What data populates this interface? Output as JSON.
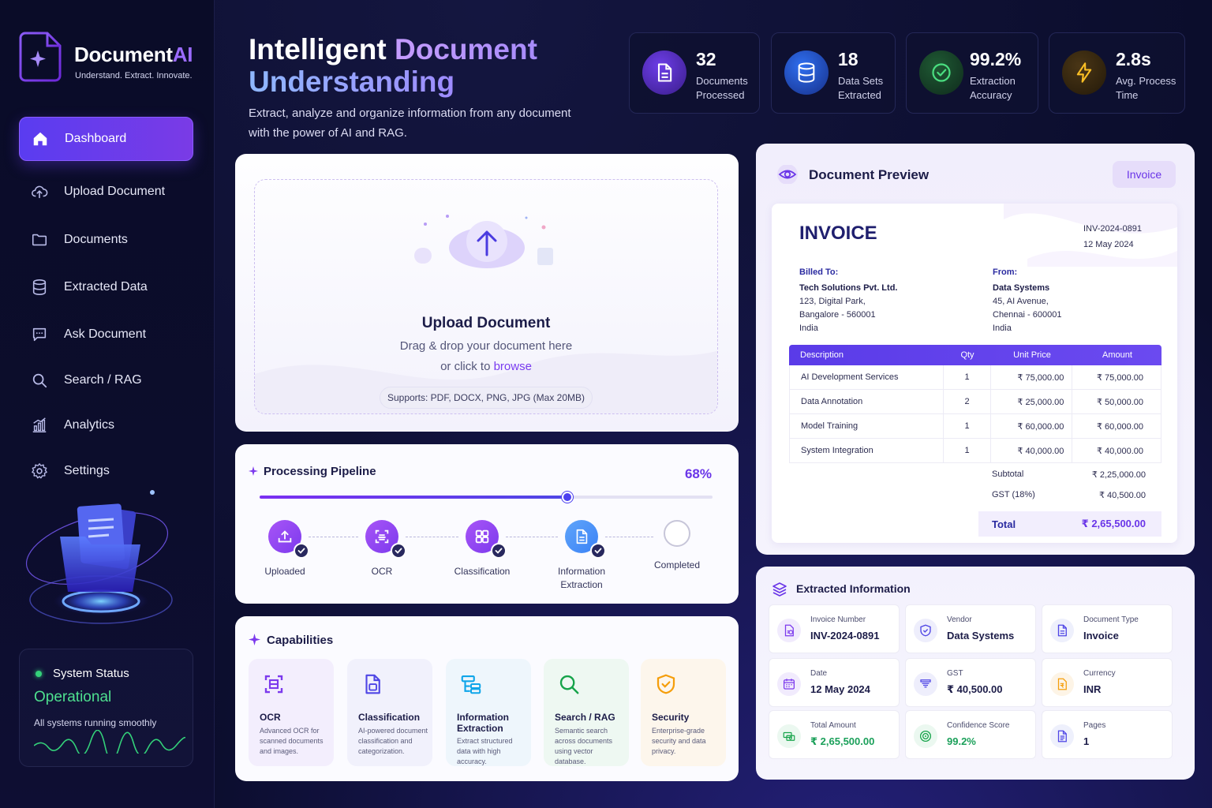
{
  "brand": {
    "name_main": "Document",
    "name_accent": "AI",
    "tagline": "Understand. Extract. Innovate."
  },
  "nav": [
    {
      "label": "Dashboard",
      "icon": "home-icon",
      "active": true
    },
    {
      "label": "Upload Document",
      "icon": "cloud-upload-icon"
    },
    {
      "label": "Documents",
      "icon": "folder-icon"
    },
    {
      "label": "Extracted Data",
      "icon": "database-icon"
    },
    {
      "label": "Ask Document",
      "icon": "chat-icon"
    },
    {
      "label": "Search / RAG",
      "icon": "search-icon"
    },
    {
      "label": "Analytics",
      "icon": "analytics-icon"
    },
    {
      "label": "Settings",
      "icon": "gear-icon"
    }
  ],
  "system_status": {
    "label": "System Status",
    "state": "Operational",
    "message": "All systems running smoothly"
  },
  "hero": {
    "title_white": "Intelligent",
    "title_accent1": "Document",
    "title_accent2": "Understanding",
    "subtitle": "Extract, analyze and organize information from any document with the power of AI and RAG."
  },
  "stats": [
    {
      "value": "32",
      "label1": "Documents",
      "label2": "Processed",
      "icon": "document-icon",
      "color": "#7c3aed"
    },
    {
      "value": "18",
      "label1": "Data Sets",
      "label2": "Extracted",
      "icon": "database-icon",
      "color": "#2563eb"
    },
    {
      "value": "99.2%",
      "label1": "Extraction",
      "label2": "Accuracy",
      "icon": "check-circle-icon",
      "color": "#22c55e"
    },
    {
      "value": "2.8s",
      "label1": "Avg. Process",
      "label2": "Time",
      "icon": "lightning-icon",
      "color": "#f59e0b"
    }
  ],
  "upload": {
    "title": "Upload Document",
    "line1": "Drag & drop your document here",
    "line2_prefix": "or click to ",
    "line2_link": "browse",
    "supports": "Supports: PDF, DOCX, PNG, JPG  (Max 20MB)"
  },
  "pipeline": {
    "title": "Processing Pipeline",
    "percent_label": "68%",
    "progress": 0.68,
    "steps": [
      {
        "label": "Uploaded",
        "done": true,
        "icon": "upload-icon"
      },
      {
        "label": "OCR",
        "done": true,
        "icon": "ocr-icon"
      },
      {
        "label": "Classification",
        "done": true,
        "icon": "grid-icon"
      },
      {
        "label": "Information\nExtraction",
        "done": true,
        "icon": "document-icon"
      },
      {
        "label": "Completed",
        "done": false,
        "icon": "empty-circle-icon"
      }
    ]
  },
  "capabilities": {
    "title": "Capabilities",
    "items": [
      {
        "name": "OCR",
        "desc": "Advanced OCR for scanned documents and images.",
        "icon": "scan-icon",
        "color": "#7c3aed",
        "bg": "#f3eefd"
      },
      {
        "name": "Classification",
        "desc": "AI-powered document classification and categorization.",
        "icon": "file-tag-icon",
        "color": "#4f46e5",
        "bg": "#f1f1fc"
      },
      {
        "name": "Information Extraction",
        "desc": "Extract structured data with high accuracy.",
        "icon": "extract-icon",
        "color": "#0ea5e9",
        "bg": "#eef6fc"
      },
      {
        "name": "Search / RAG",
        "desc": "Semantic search across documents using vector database.",
        "icon": "search-icon",
        "color": "#16a34a",
        "bg": "#eef8f2"
      },
      {
        "name": "Security",
        "desc": "Enterprise-grade security and data privacy.",
        "icon": "shield-icon",
        "color": "#f59e0b",
        "bg": "#fdf6ec"
      }
    ]
  },
  "preview": {
    "title": "Document Preview",
    "badge": "Invoice",
    "invoice": {
      "heading": "INVOICE",
      "number": "INV-2024-0891",
      "date": "12 May 2024",
      "billed_to": {
        "label": "Billed To:",
        "name": "Tech Solutions Pvt. Ltd.",
        "lines": [
          "123, Digital Park,",
          "Bangalore - 560001",
          "India"
        ]
      },
      "from": {
        "label": "From:",
        "name": "Data Systems",
        "lines": [
          "45, AI Avenue,",
          "Chennai - 600001",
          "India"
        ]
      },
      "columns": [
        "Description",
        "Qty",
        "Unit Price",
        "Amount"
      ],
      "rows": [
        [
          "AI Development Services",
          "1",
          "₹ 75,000.00",
          "₹ 75,000.00"
        ],
        [
          "Data Annotation",
          "2",
          "₹ 25,000.00",
          "₹ 50,000.00"
        ],
        [
          "Model Training",
          "1",
          "₹ 60,000.00",
          "₹ 60,000.00"
        ],
        [
          "System Integration",
          "1",
          "₹ 40,000.00",
          "₹ 40,000.00"
        ]
      ],
      "subtotal_label": "Subtotal",
      "subtotal": "₹ 2,25,000.00",
      "gst_label": "GST (18%)",
      "gst": "₹ 40,500.00",
      "total_label": "Total",
      "total": "₹ 2,65,500.00"
    }
  },
  "extracted": {
    "title": "Extracted Information",
    "fields": [
      {
        "label": "Invoice Number",
        "value": "INV-2024-0891",
        "icon": "invoice-icon",
        "color": "#7c3aed",
        "bg": "#f1ebfd"
      },
      {
        "label": "Vendor",
        "value": "Data Systems",
        "icon": "shield-check-icon",
        "color": "#4f46e5",
        "bg": "#eeeefc"
      },
      {
        "label": "Document Type",
        "value": "Invoice",
        "icon": "document-icon",
        "color": "#4f46e5",
        "bg": "#eef0fc"
      },
      {
        "label": "Date",
        "value": "12 May 2024",
        "icon": "calendar-icon",
        "color": "#7c3aed",
        "bg": "#f1ebfd"
      },
      {
        "label": "GST",
        "value": "₹ 40,500.00",
        "icon": "tax-icon",
        "color": "#4f46e5",
        "bg": "#eeeefc"
      },
      {
        "label": "Currency",
        "value": "INR",
        "icon": "currency-doc-icon",
        "color": "#f59e0b",
        "bg": "#fdf4e6"
      },
      {
        "label": "Total Amount",
        "value": "₹ 2,65,500.00",
        "icon": "cash-icon",
        "color": "#16a34a",
        "bg": "#ebf8f0",
        "green": true
      },
      {
        "label": "Confidence Score",
        "value": "99.2%",
        "icon": "target-icon",
        "color": "#16a34a",
        "bg": "#ebf8f0",
        "green": true
      },
      {
        "label": "Pages",
        "value": "1",
        "icon": "page-icon",
        "color": "#4f46e5",
        "bg": "#eef0fc"
      }
    ]
  }
}
